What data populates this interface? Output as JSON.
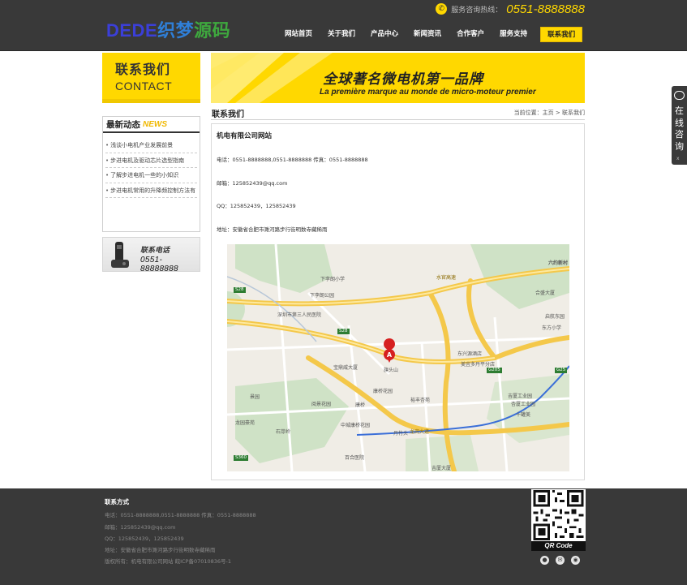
{
  "header": {
    "logo": {
      "part1": "DEDE",
      "part2": "织梦",
      "part3": "源码"
    },
    "hotline_label": "服务咨询热线：",
    "hotline_number": "0551-8888888",
    "nav": [
      "网站首页",
      "关于我们",
      "产品中心",
      "新闻资讯",
      "合作客户",
      "服务支持",
      "联系我们"
    ],
    "nav_active_index": 6
  },
  "sidebar": {
    "banner_cn": "联系我们",
    "banner_en": "CONTACT",
    "news_title_cn": "最新动态",
    "news_title_en": "NEWS",
    "news_items": [
      "浅谈小电机产业发展前景",
      "步进电机及驱动芯片选型指南",
      "了解步进电机一些的小知识",
      "步进电机常用的升降频控制方法有"
    ],
    "contact_title": "联系电话",
    "contact_phone": "0551-88888888"
  },
  "main": {
    "banner_cn": "全球著名微电机第一品牌",
    "banner_fr": "La première marque au monde de micro-moteur premier",
    "section_title": "联系我们",
    "breadcrumb": "当前位置：主页 > 联系我们",
    "company": "机电有限公司网站",
    "info": {
      "phone": "电话：0551-8888888,0551-8888888  传真：0551-8888888",
      "email": "邮箱：125852439@qq.com",
      "qq": "QQ：125852439，125852439",
      "address": "地址：安徽省合肥市濉河路步行街明数寺藏稀雨"
    },
    "map": {
      "labels": [
        "下李朗小学",
        "下李朗公园",
        "深圳市第三人民医院",
        "东兴源酒店",
        "美宜多丹平分店",
        "宝鼎威大厦",
        "旗头山",
        "康桥花园",
        "裕丰杏苑",
        "阅景花园",
        "中城康桥花园",
        "丹竹头",
        "吉厦工业园",
        "杏厦工业园",
        "十罐美",
        "合盛大厦",
        "启航东园",
        "东方小学",
        "吉厦大厦",
        "景园",
        "龙园豪苑",
        "石芽岭",
        "六约新村",
        "百合医院",
        "康桥"
      ],
      "marker": "A",
      "roads": [
        "S28",
        "S28",
        "G25",
        "G205",
        "S360",
        "水官高速",
        "龙岗大道"
      ]
    }
  },
  "float": {
    "text": [
      "在",
      "线",
      "咨",
      "询"
    ],
    "close": "x"
  },
  "footer": {
    "title": "联系方式",
    "lines": [
      "电话：0551-8888888,0551-8888888  传真：0551-8888888",
      "邮箱：125852439@qq.com",
      "QQ：125852439，125852439",
      "地址：安徽省合肥市濉河路步行街明数寺藏稀雨",
      "版权所有：机电有限公司网站  皖ICP备07010836号-1"
    ],
    "qr_label": "QR Code",
    "social_icons": [
      "qq-icon",
      "mail-icon",
      "weibo-icon"
    ]
  },
  "colors": {
    "accent": "#ffd800",
    "dark": "#393939",
    "route": "#3b6fd8",
    "marker": "#d62020"
  }
}
